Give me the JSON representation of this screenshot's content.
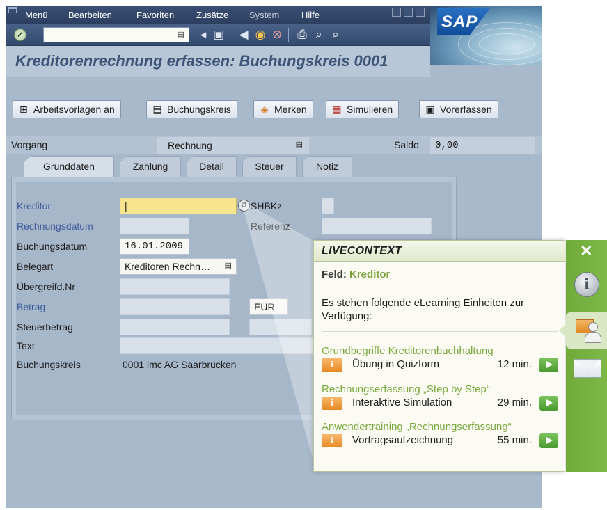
{
  "menu": {
    "items": [
      {
        "label": "Menü",
        "dim": false
      },
      {
        "label": "Bearbeiten",
        "dim": false
      },
      {
        "label": "Favoriten",
        "dim": false
      },
      {
        "label": "Zusätze",
        "dim": false
      },
      {
        "label": "System",
        "dim": true
      },
      {
        "label": "Hilfe",
        "dim": false
      }
    ]
  },
  "brand": {
    "logo_text": "SAP"
  },
  "toolbar": {
    "command_value": ""
  },
  "page": {
    "title": "Kreditorenrechnung erfassen: Buchungskreis 0001"
  },
  "app_toolbar": {
    "buttons": [
      {
        "label": "Arbeitsvorlagen an"
      },
      {
        "label": "Buchungskreis"
      },
      {
        "label": "Merken"
      },
      {
        "label": "Simulieren"
      },
      {
        "label": "Vorerfassen"
      }
    ]
  },
  "header": {
    "vorgang_label": "Vorgang",
    "vorgang_value": "Rechnung",
    "saldo_label": "Saldo",
    "saldo_value": "0,00"
  },
  "tabs": [
    {
      "label": "Grunddaten",
      "active": true
    },
    {
      "label": "Zahlung",
      "active": false
    },
    {
      "label": "Detail",
      "active": false
    },
    {
      "label": "Steuer",
      "active": false
    },
    {
      "label": "Notiz",
      "active": false
    }
  ],
  "form": {
    "kreditor_label": "Kreditor",
    "kreditor_value": "|",
    "shbkz_label": "SHBKz",
    "rechnungsdatum_label": "Rechnungsdatum",
    "referenz_label": "Referenz",
    "buchungsdatum_label": "Buchungsdatum",
    "buchungsdatum_value": "16.01.2009",
    "belegart_label": "Belegart",
    "belegart_value": "Kreditoren Rechn…",
    "uebergreifd_label": "Übergreifd.Nr",
    "betrag_label": "Betrag",
    "waehrung_value": "EUR",
    "steuerbetrag_label": "Steuerbetrag",
    "text_label": "Text",
    "buchungskreis_label": "Buchungskreis",
    "buchungskreis_value": "0001 imc AG Saarbrücken"
  },
  "livecontext": {
    "brand": "LIVECONTEXT",
    "feld_label": "Feld:",
    "feld_value": "Kreditor",
    "intro": "Es stehen folgende eLearning Einheiten zur Verfügung:",
    "close_label": "✕",
    "courses": [
      {
        "title": "Grundbegriffe Kreditorenbuchhaltung",
        "badge": "i",
        "name": "Übung in Quizform",
        "duration": "12 min."
      },
      {
        "title": "Rechnungserfassung „Step by Step“",
        "badge": "i",
        "name": "Interaktive Simulation",
        "duration": "29 min."
      },
      {
        "title": "Anwendertraining „Rechnungserfassung“",
        "badge": "i",
        "name": "Vortragsaufzeichnung",
        "duration": "55 min."
      }
    ]
  },
  "colors": {
    "sap_background": "#a9b9cc",
    "title_text": "#3c5577",
    "required_field": "#f7e58e",
    "livecontext_green": "#78a93c",
    "badge_orange": "#e88a22"
  }
}
